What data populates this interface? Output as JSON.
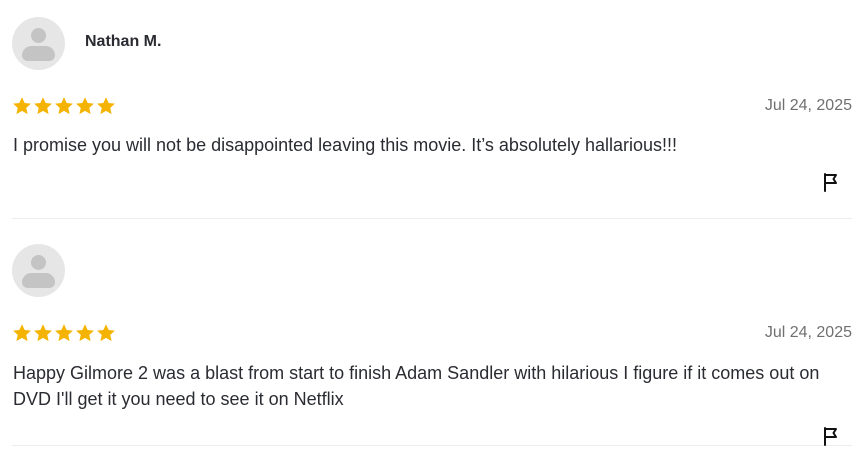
{
  "reviews": [
    {
      "name": "Nathan M.",
      "rating": 5,
      "rating_max": 5,
      "date": "Jul 24, 2025",
      "text": "I promise you will not be disappointed leaving this movie. It’s absolutely hallarious!!!"
    },
    {
      "name": "",
      "rating": 5,
      "rating_max": 5,
      "date": "Jul 24, 2025",
      "text": "Happy Gilmore 2 was a blast from start to finish Adam Sandler with hilarious I figure if it comes out on DVD I'll get it you need to see it on Netflix"
    }
  ],
  "colors": {
    "star": "#f5b301",
    "avatar_bg": "#e6e6e6",
    "avatar_fg": "#c4c4c4",
    "date": "#707070",
    "text": "#2a2c32"
  },
  "icons": {
    "avatar": "user-avatar-placeholder",
    "star": "star-filled",
    "flag": "flag-report"
  }
}
